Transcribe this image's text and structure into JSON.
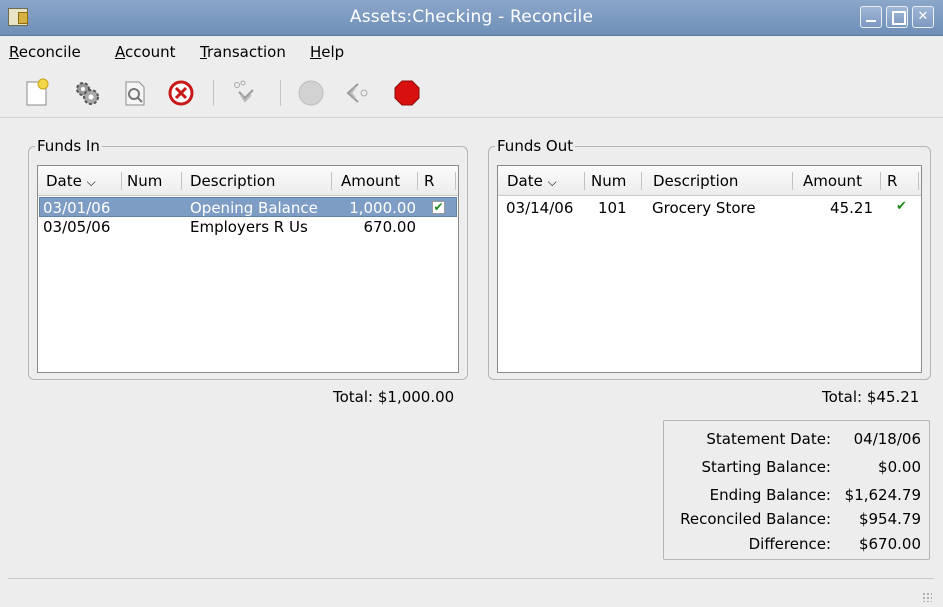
{
  "window": {
    "title": "Assets:Checking - Reconcile"
  },
  "menu": [
    {
      "label": "Reconcile",
      "underline": "R",
      "rest": "econcile"
    },
    {
      "label": "Account",
      "underline": "A",
      "rest": "ccount"
    },
    {
      "label": "Transaction",
      "underline": "T",
      "rest": "ransaction"
    },
    {
      "label": "Help",
      "underline": "H",
      "rest": "elp"
    }
  ],
  "toolbar": {
    "icons": [
      "new-transaction-icon",
      "edit-account-icon",
      "open-transaction-icon",
      "delete-transaction-icon",
      "balance-icon",
      "finish-icon",
      "postpone-icon",
      "cancel-icon"
    ]
  },
  "funds_in": {
    "label": "Funds In",
    "columns": {
      "date": "Date",
      "num": "Num",
      "description": "Description",
      "amount": "Amount",
      "r": "R"
    },
    "rows": [
      {
        "date": "03/01/06",
        "num": "",
        "description": "Opening Balance",
        "amount": "1,000.00",
        "reconciled": true,
        "selected": true
      },
      {
        "date": "03/05/06",
        "num": "",
        "description": "Employers R Us",
        "amount": "670.00",
        "reconciled": false,
        "selected": false
      }
    ],
    "total": "Total: $1,000.00"
  },
  "funds_out": {
    "label": "Funds Out",
    "columns": {
      "date": "Date",
      "num": "Num",
      "description": "Description",
      "amount": "Amount",
      "r": "R"
    },
    "rows": [
      {
        "date": "03/14/06",
        "num": "101",
        "description": "Grocery Store",
        "amount": "45.21",
        "reconciled": true,
        "selected": false
      }
    ],
    "total": "Total: $45.21"
  },
  "summary": {
    "statement_date_label": "Statement Date:",
    "statement_date": "04/18/06",
    "starting_balance_label": "Starting Balance:",
    "starting_balance": "$0.00",
    "ending_balance_label": "Ending Balance:",
    "ending_balance": "$1,624.79",
    "reconciled_balance_label": "Reconciled Balance:",
    "reconciled_balance": "$954.79",
    "difference_label": "Difference:",
    "difference": "$670.00"
  },
  "colors": {
    "selection": "#7e9dc4",
    "titlebar": "#7d99c0",
    "check": "#1d8a1d"
  }
}
